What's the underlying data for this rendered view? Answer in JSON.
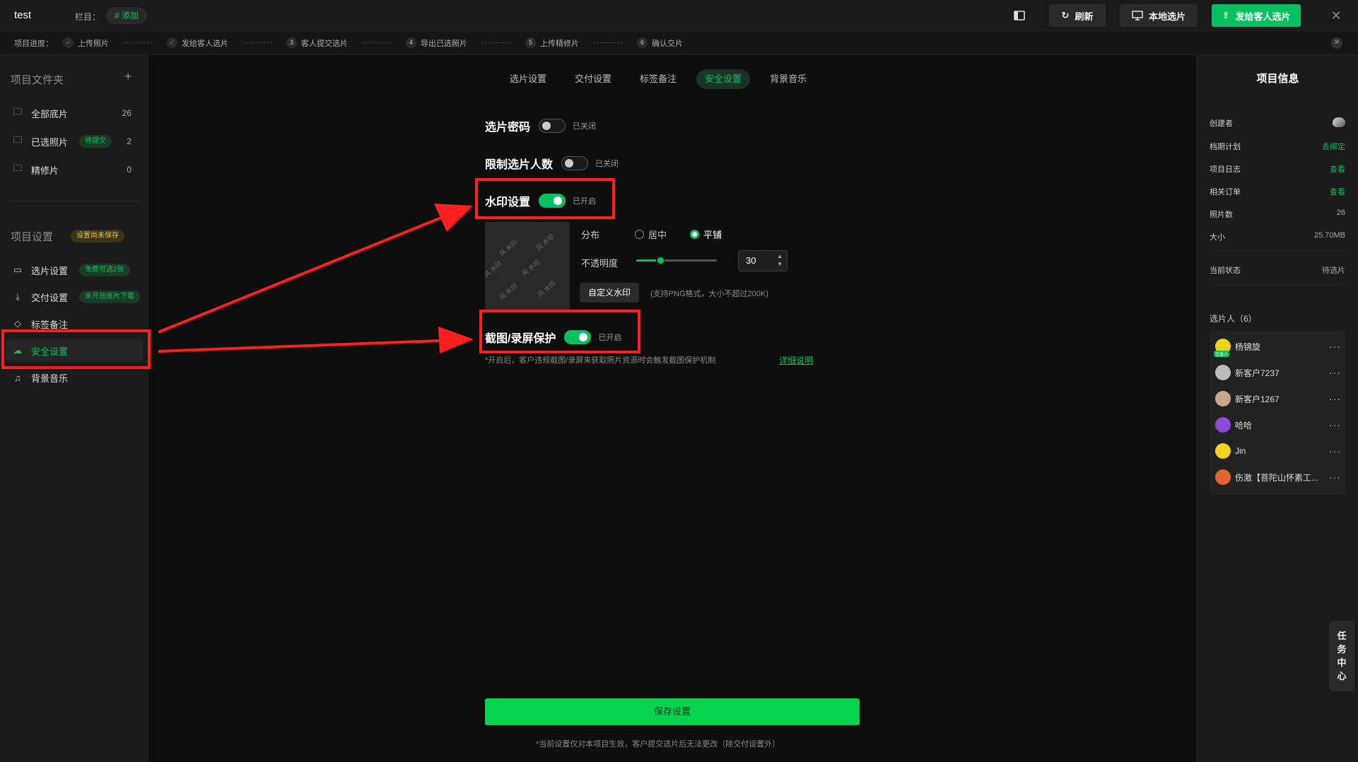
{
  "topbar": {
    "app_title": "test",
    "column_label": "栏目：",
    "add_chip": "# 添加",
    "refresh": "刷新",
    "local_pick": "本地选片",
    "send_to_client": "发给客人选片"
  },
  "progress": {
    "label": "项目进度：",
    "steps": [
      {
        "num": "✓",
        "label": "上传照片"
      },
      {
        "num": "✓",
        "label": "发给客人选片"
      },
      {
        "num": "3",
        "label": "客人提交选片"
      },
      {
        "num": "4",
        "label": "导出已选照片"
      },
      {
        "num": "5",
        "label": "上传精修片"
      },
      {
        "num": "6",
        "label": "确认交片"
      }
    ]
  },
  "sidebar": {
    "folders_heading": "项目文件夹",
    "add": "+",
    "folders": [
      {
        "label": "全部底片",
        "count": "26"
      },
      {
        "label": "已选照片",
        "badge": "待提交",
        "count": "2"
      },
      {
        "label": "精修片",
        "count": "0"
      }
    ],
    "settings_heading": "项目设置",
    "settings_badge": "设置尚未保存",
    "settings": [
      {
        "label": "选片设置",
        "badge": "免费可选2张"
      },
      {
        "label": "交付设置",
        "badge": "未开放底片下载"
      },
      {
        "label": "标签备注"
      },
      {
        "label": "安全设置"
      },
      {
        "label": "背景音乐"
      }
    ]
  },
  "tabs": [
    "选片设置",
    "交付设置",
    "标签备注",
    "安全设置",
    "背景音乐"
  ],
  "security": {
    "pick_password": {
      "title": "选片密码",
      "state": "已关闭"
    },
    "limit_pickers": {
      "title": "限制选片人数",
      "state": "已关闭"
    },
    "watermark": {
      "title": "水印设置",
      "state": "已开启",
      "preview_text": "风 水印",
      "distribution_label": "分布",
      "option_center": "居中",
      "option_tile": "平铺",
      "opacity_label": "不透明度",
      "opacity_value": "30",
      "opacity": 30,
      "custom_button": "自定义水印",
      "custom_hint": "(支持PNG格式，大小不超过200K)"
    },
    "screenshot": {
      "title": "截图/录屏保护",
      "state": "已开启",
      "hint": "*开启后，客户违规截图/录屏来获取照片资源时会触发截图保护机制",
      "link": "详细说明"
    },
    "save_button": "保存设置",
    "footnote": "*当前设置仅对本项目生效，客户提交选片后无法更改（除交付设置外）"
  },
  "info": {
    "title": "项目信息",
    "rows": [
      {
        "k": "创建者",
        "v": ""
      },
      {
        "k": "档期计划",
        "v": "去绑定"
      },
      {
        "k": "项目日志",
        "v": "查看"
      },
      {
        "k": "相关订单",
        "v": "查看"
      },
      {
        "k": "照片数",
        "v": "26"
      },
      {
        "k": "大小",
        "v": "25.70MB"
      },
      {
        "k": "当前状态",
        "v": "待选片"
      }
    ],
    "pickers_heading": "选片人（6）",
    "pickers": [
      "杨锦旋",
      "新客户7237",
      "新客户1267",
      "哈哈",
      "Jin",
      "伤激【菩陀山怀素工..."
    ],
    "owner_tag": "主选人"
  },
  "task_center": [
    "任",
    "务",
    "中",
    "心"
  ],
  "colors": {
    "accent": "#07c160",
    "annotation": "#ff1f1f",
    "background": "#0e0e0e"
  }
}
